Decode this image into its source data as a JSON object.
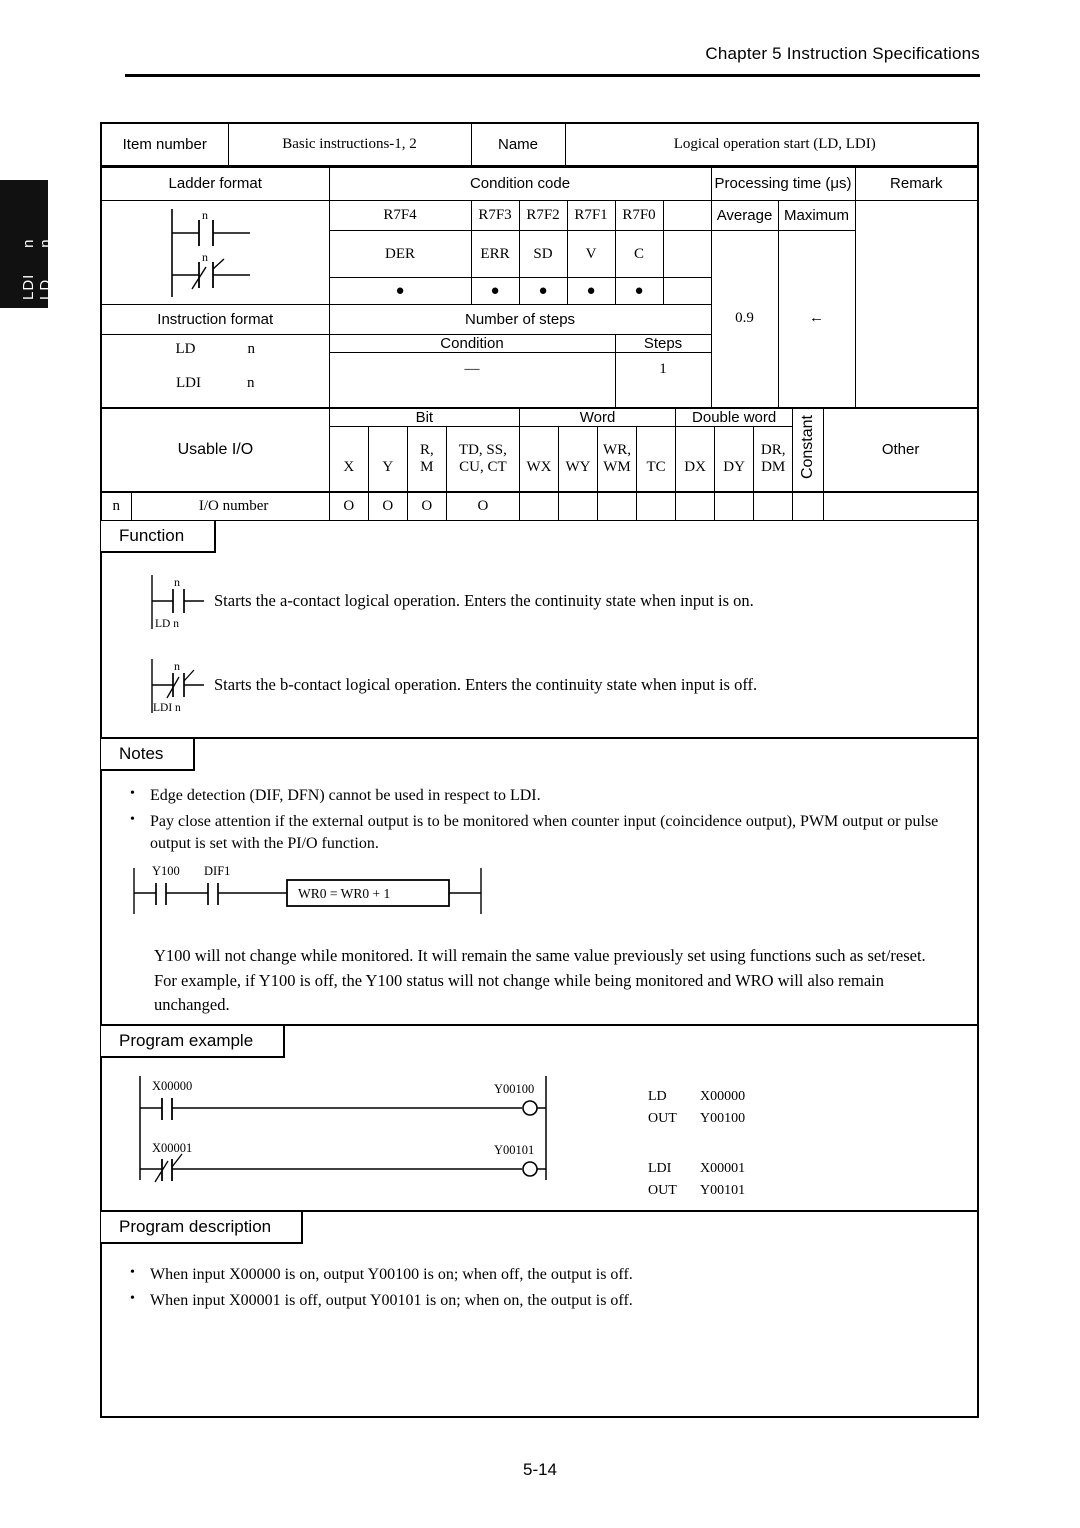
{
  "header": {
    "chapter": "Chapter 5  Instruction Specifications"
  },
  "side_tab": {
    "line1": "LD",
    "line2": "LDI",
    "sub1": "n",
    "sub2": "n"
  },
  "page_number": "5-14",
  "info": {
    "item_number_label": "Item number",
    "item_number_value": "Basic instructions-1, 2",
    "name_label": "Name",
    "name_value": "Logical operation start (LD, LDI)"
  },
  "headers": {
    "ladder_format": "Ladder format",
    "condition_code": "Condition code",
    "processing_time": "Processing time (μs)",
    "remark": "Remark",
    "instruction_format": "Instruction format",
    "number_of_steps": "Number of steps",
    "condition": "Condition",
    "steps": "Steps",
    "average": "Average",
    "maximum": "Maximum"
  },
  "condition_code": {
    "registers": [
      "R7F4",
      "R7F3",
      "R7F2",
      "R7F1",
      "R7F0"
    ],
    "flags": [
      "DER",
      "ERR",
      "SD",
      "V",
      "C"
    ],
    "marks": [
      "●",
      "●",
      "●",
      "●",
      "●"
    ]
  },
  "processing_time": {
    "average": "0.9",
    "maximum": "←"
  },
  "instruction_format": {
    "rows": [
      {
        "mnemonic": "LD",
        "operand": "n"
      },
      {
        "mnemonic": "LDI",
        "operand": "n"
      }
    ],
    "steps_row": {
      "condition": "—",
      "steps": "1"
    }
  },
  "usable_io": {
    "title": "Usable I/O",
    "groups": [
      {
        "label": "Bit",
        "span": 4
      },
      {
        "label": "Word",
        "span": 4
      },
      {
        "label": "Double word",
        "span": 3
      }
    ],
    "constant_label": "Constant",
    "other_label": "Other",
    "columns": [
      {
        "top": "",
        "bottom": "X"
      },
      {
        "top": "",
        "bottom": "Y"
      },
      {
        "top": "R,",
        "bottom": "M"
      },
      {
        "top": "TD, SS,",
        "bottom": "CU, CT"
      },
      {
        "top": "",
        "bottom": "WX"
      },
      {
        "top": "",
        "bottom": "WY"
      },
      {
        "top": "WR,",
        "bottom": "WM"
      },
      {
        "top": "",
        "bottom": "TC"
      },
      {
        "top": "",
        "bottom": "DX"
      },
      {
        "top": "",
        "bottom": "DY"
      },
      {
        "top": "DR,",
        "bottom": "DM"
      }
    ],
    "row": {
      "operand": "n",
      "label": "I/O number",
      "values": [
        "O",
        "O",
        "O",
        "O",
        "",
        "",
        "",
        "",
        "",
        "",
        ""
      ],
      "constant": "",
      "other": ""
    }
  },
  "function": {
    "tag": "Function",
    "entries": [
      {
        "contact": "a",
        "operand": "n",
        "caption": "LD n",
        "text": "Starts the a-contact logical operation. Enters the continuity state when input is on."
      },
      {
        "contact": "b",
        "operand": "n",
        "caption": "LDI n",
        "text": "Starts the b-contact logical operation. Enters the continuity state when input is off."
      }
    ]
  },
  "notes": {
    "tag": "Notes",
    "bullets": [
      "Edge detection (DIF, DFN) cannot be used in respect to LDI.",
      "Pay close attention if the external output is to be monitored when counter input (coincidence output), PWM output or pulse output is set with the PI/O function."
    ],
    "diagram": {
      "contact1": "Y100",
      "contact2": "DIF1",
      "box_text": "WR0 = WR0 + 1"
    },
    "paragraphs": [
      "Y100 will not change while monitored. It will remain the same value previously set using functions such as set/reset.",
      "For example, if Y100 is off, the Y100 status will not change while being monitored and WRO will also remain unchanged."
    ]
  },
  "program_example": {
    "tag": "Program example",
    "rungs": [
      {
        "input": "X00000",
        "input_type": "a",
        "output": "Y00100"
      },
      {
        "input": "X00001",
        "input_type": "b",
        "output": "Y00101"
      }
    ],
    "mnemonics": [
      {
        "op": "LD",
        "arg": "X00000"
      },
      {
        "op": "OUT",
        "arg": "Y00100"
      },
      {
        "op": "LDI",
        "arg": "X00001"
      },
      {
        "op": "OUT",
        "arg": "Y00101"
      }
    ]
  },
  "program_description": {
    "tag": "Program description",
    "bullets": [
      "When input X00000 is on, output Y00100 is on; when off, the output is off.",
      "When input X00001 is off, output Y00101 is on; when on, the output is off."
    ]
  }
}
